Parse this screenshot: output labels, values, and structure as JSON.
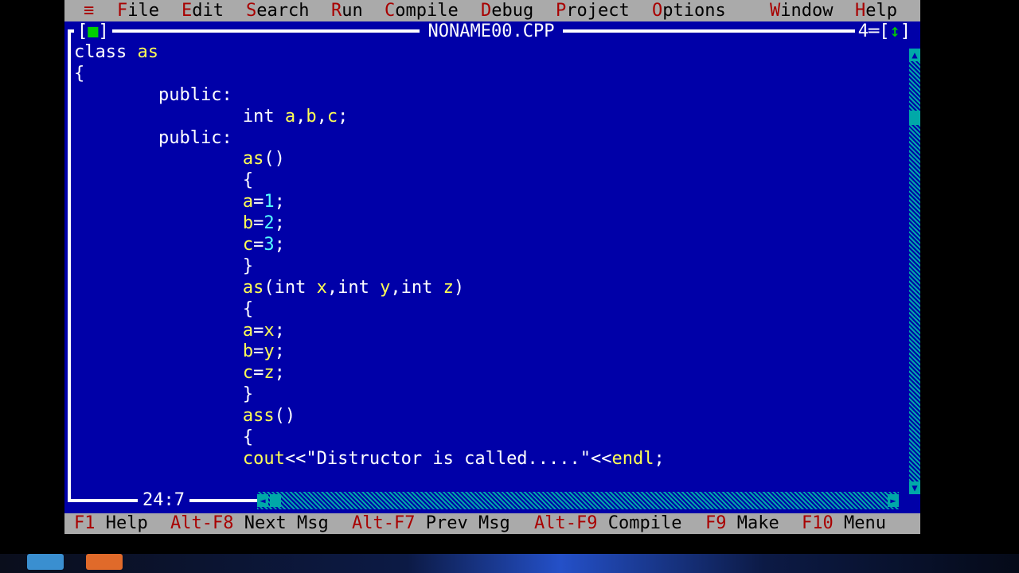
{
  "menu": {
    "system": "≡",
    "items": [
      {
        "hotkey": "F",
        "rest": "ile"
      },
      {
        "hotkey": "E",
        "rest": "dit"
      },
      {
        "hotkey": "S",
        "rest": "earch"
      },
      {
        "hotkey": "R",
        "rest": "un"
      },
      {
        "hotkey": "C",
        "rest": "ompile"
      },
      {
        "hotkey": "D",
        "rest": "ebug"
      },
      {
        "hotkey": "P",
        "rest": "roject"
      },
      {
        "hotkey": "O",
        "rest": "ptions"
      },
      {
        "hotkey": "W",
        "rest": "indow"
      },
      {
        "hotkey": "H",
        "rest": "elp"
      }
    ]
  },
  "window": {
    "title": "NONAME00.CPP",
    "close_left": "[",
    "close_mark": "■",
    "close_right": "]",
    "number": "4",
    "zoom_left": "[",
    "zoom_mark": "↕",
    "zoom_right": "]",
    "cursor_pos": "24:7"
  },
  "code_lines": [
    "class as",
    "{",
    "        public:",
    "                int a,b,c;",
    "        public:",
    "                as()",
    "                {",
    "                a=1;",
    "                b=2;",
    "                c=3;",
    "                }",
    "                as(int x,int y,int z)",
    "                {",
    "                a=x;",
    "                b=y;",
    "                c=z;",
    "                }",
    "                ass()",
    "                {",
    "                cout<<\"Distructor is called.....\"<<endl;"
  ],
  "status": {
    "keys": [
      {
        "key": "F1",
        "label": "Help"
      },
      {
        "key": "Alt-F8",
        "label": "Next Msg"
      },
      {
        "key": "Alt-F7",
        "label": "Prev Msg"
      },
      {
        "key": "Alt-F9",
        "label": "Compile"
      },
      {
        "key": "F9",
        "label": "Make"
      },
      {
        "key": "F10",
        "label": "Menu"
      }
    ]
  },
  "colors": {
    "editor_bg": "#0000a8",
    "menu_bg": "#aaaaaa",
    "hotkey": "#a80000",
    "identifier": "#ffff55",
    "keyword": "#ffffff",
    "number": "#55ffff"
  }
}
